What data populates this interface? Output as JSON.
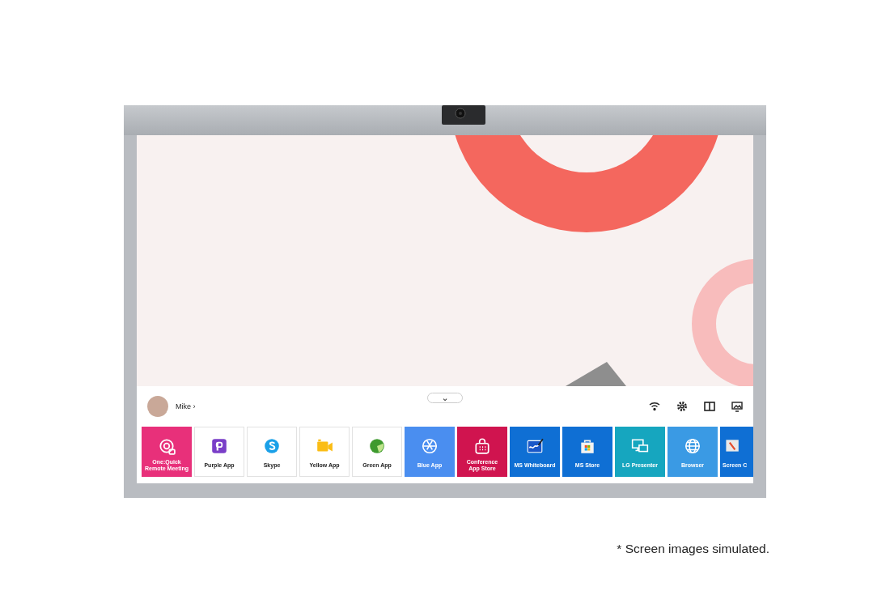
{
  "user": {
    "name": "Mike ›"
  },
  "launcher": {
    "collapse_button": "⌄"
  },
  "apps": [
    {
      "label": "One:Quick\nRemote Meeting",
      "kind": "meeting",
      "color": "#e8307a",
      "cut": false
    },
    {
      "label": "Purple App",
      "kind": "purple",
      "color": "#ffffff",
      "cut": false
    },
    {
      "label": "Skype",
      "kind": "skype",
      "color": "#ffffff",
      "cut": false
    },
    {
      "label": "Yellow App",
      "kind": "camera",
      "color": "#ffffff",
      "cut": false
    },
    {
      "label": "Green App",
      "kind": "green",
      "color": "#ffffff",
      "cut": false
    },
    {
      "label": "Blue App",
      "kind": "aperture",
      "color": "#4a8ef0",
      "cut": false
    },
    {
      "label": "Conference\nApp Store",
      "kind": "store",
      "color": "#d0144f",
      "cut": false
    },
    {
      "label": "MS Whiteboard",
      "kind": "whiteboard",
      "color": "#0f6fd4",
      "cut": false
    },
    {
      "label": "MS Store",
      "kind": "bag",
      "color": "#0f6fd4",
      "cut": false
    },
    {
      "label": "LG Presenter",
      "kind": "presenter",
      "color": "#16a6bf",
      "cut": false
    },
    {
      "label": "Browser",
      "kind": "globe",
      "color": "#3a9ae4",
      "cut": false
    },
    {
      "label": "Screen C",
      "kind": "share",
      "color": "#0f6fd4",
      "cut": true
    }
  ],
  "footnote": "* Screen images simulated."
}
